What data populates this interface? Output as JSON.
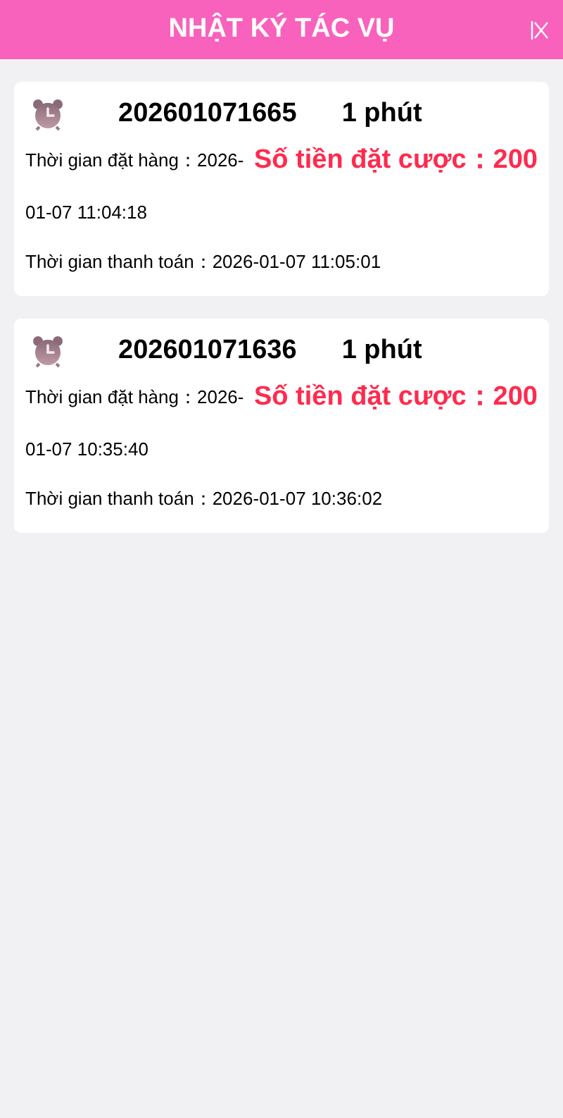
{
  "header": {
    "title": "NHẬT KÝ TÁC VỤ"
  },
  "orders": [
    {
      "order_id": "202601071665",
      "duration": "1 phút",
      "order_time": "Thời gian đặt hàng：2026-01-07 11:04:18",
      "bet_amount": "Số tiền đặt cược：200",
      "payment_time": "Thời gian thanh toán：2026-01-07 11:05:01"
    },
    {
      "order_id": "202601071636",
      "duration": "1 phút",
      "order_time": "Thời gian đặt hàng：2026-01-07 10:35:40",
      "bet_amount": "Số tiền đặt cược：200",
      "payment_time": "Thời gian thanh toán：2026-01-07 10:36:02"
    }
  ]
}
